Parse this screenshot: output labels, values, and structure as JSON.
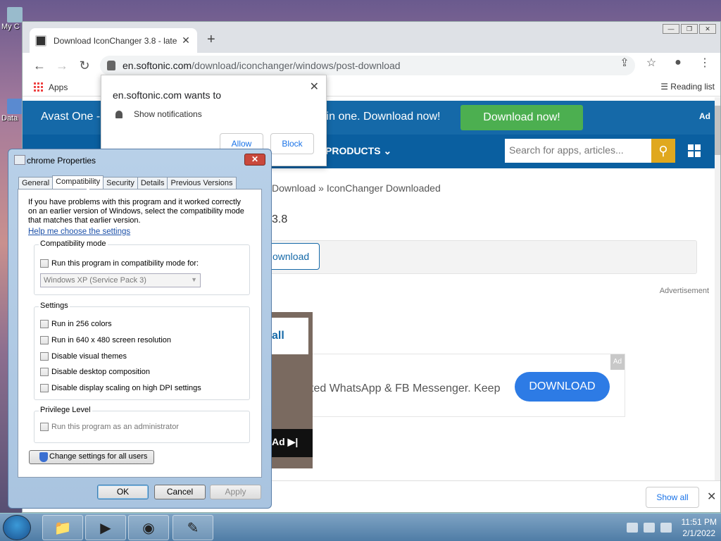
{
  "desktop": {
    "icons": [
      {
        "label": "My C"
      },
      {
        "label": "Data"
      }
    ]
  },
  "browser": {
    "tab_title": "Download IconChanger 3.8 - late",
    "url_host": "en.softonic.com",
    "url_path": "/download/iconchanger/windows/post-download",
    "bookmarks_apps": "Apps",
    "reading_list": "Reading list"
  },
  "notification": {
    "heading": "en.softonic.com wants to",
    "permission": "Show notifications",
    "allow": "Allow",
    "block": "Block"
  },
  "page": {
    "avast_left": "Avast One -",
    "avast_mid": "ll in one. Download now!",
    "avast_button": "Download now!",
    "avast_ad": "Ad",
    "nav_products": "PRODUCTS",
    "search_placeholder": "Search for apps, articles...",
    "breadcrumb_1": "Download",
    "breadcrumb_sep": "»",
    "breadcrumb_2": "IconChanger Downloaded",
    "version": "3.8",
    "download_button": "ownload",
    "advertisement": "Advertisement",
    "video_ad_text": "all",
    "video_ad_label": "Ad",
    "ad2_text": "ted WhatsApp & FB Messenger. Keep",
    "ad2_button": "DOWNLOAD",
    "ad2_badge": "Ad"
  },
  "download_shelf": {
    "show_all": "Show all"
  },
  "dialog": {
    "title": "chrome Properties",
    "tabs": [
      "General",
      "Compatibility",
      "Security",
      "Details",
      "Previous Versions"
    ],
    "intro": "If you have problems with this program and it worked correctly on an earlier version of Windows, select the compatibility mode that matches that earlier version.",
    "help_link": "Help me choose the settings",
    "compat_group": "Compatibility mode",
    "compat_check": "Run this program in compatibility mode for:",
    "compat_select": "Windows XP (Service Pack 3)",
    "settings_group": "Settings",
    "settings": [
      "Run in 256 colors",
      "Run in 640 x 480 screen resolution",
      "Disable visual themes",
      "Disable desktop composition",
      "Disable display scaling on high DPI settings"
    ],
    "privilege_group": "Privilege Level",
    "privilege_check": "Run this program as an administrator",
    "change_all": "Change settings for all users",
    "ok": "OK",
    "cancel": "Cancel",
    "apply": "Apply"
  },
  "taskbar": {
    "time": "11:51 PM",
    "date": "2/1/2022"
  }
}
